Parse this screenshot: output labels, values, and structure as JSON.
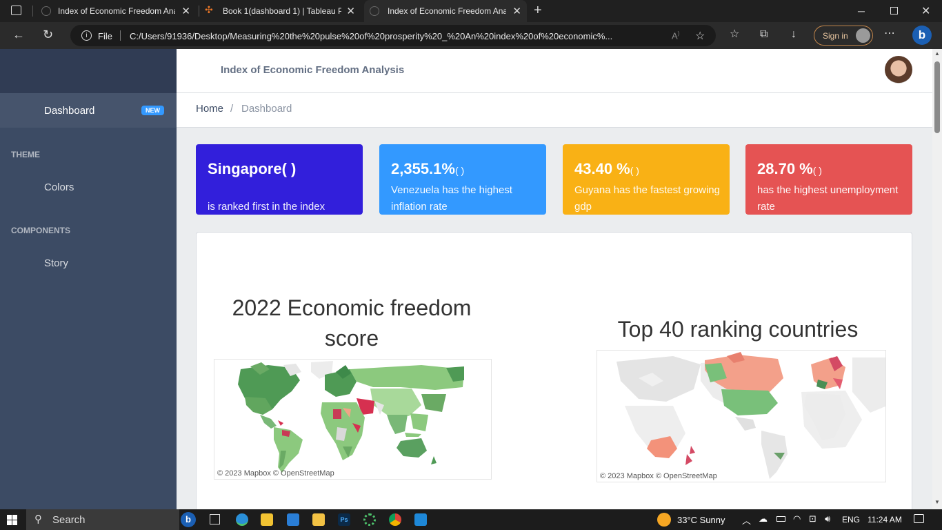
{
  "browser": {
    "tabs": [
      {
        "title": "Index of Economic Freedom Ana",
        "active": false
      },
      {
        "title": "Book 1(dashboard 1) | Tableau Pu",
        "active": false
      },
      {
        "title": "Index of Economic Freedom Ana",
        "active": true
      }
    ],
    "address": {
      "scheme_label": "File",
      "url": "C:/Users/91936/Desktop/Measuring%20the%20pulse%20of%20prosperity%20_%20An%20index%20of%20economic%..."
    },
    "signin_label": "Sign in"
  },
  "sidebar": {
    "dashboard_label": "Dashboard",
    "badge": "NEW",
    "theme_title": "THEME",
    "colors_label": "Colors",
    "components_title": "COMPONENTS",
    "story_label": "Story"
  },
  "header": {
    "title": "Index of Economic Freedom Analysis"
  },
  "breadcrumb": {
    "home": "Home",
    "separator": "/",
    "current": "Dashboard"
  },
  "cards": [
    {
      "value": "Singapore",
      "suffix": "(   )",
      "desc": "is ranked first in the index",
      "color": "#321fdb"
    },
    {
      "value": "2,355.1%",
      "suffix": "(   )",
      "desc": "Venezuela has the highest inflation rate",
      "color": "#3399ff"
    },
    {
      "value": "43.40 %",
      "suffix": "(   )",
      "desc": "Guyana has the fastest growing gdp",
      "color": "#f9b115"
    },
    {
      "value": "28.70 %",
      "suffix": "(   )",
      "desc": "has the highest unemployment rate",
      "color": "#e55353"
    }
  ],
  "maps": [
    {
      "title": "2022 Economic freedom score",
      "attribution": "© 2023 Mapbox  © OpenStreetMap"
    },
    {
      "title": "Top 40 ranking countries",
      "attribution": "© 2023 Mapbox  © OpenStreetMap"
    }
  ],
  "taskbar": {
    "search_label": "Search",
    "weather": "33°C  Sunny",
    "lang": "ENG",
    "time": "11:24 AM"
  },
  "colors": {
    "sidebar": "#3c4b64",
    "primary": "#321fdb",
    "info": "#3399ff",
    "warning": "#f9b115",
    "danger": "#e55353"
  }
}
